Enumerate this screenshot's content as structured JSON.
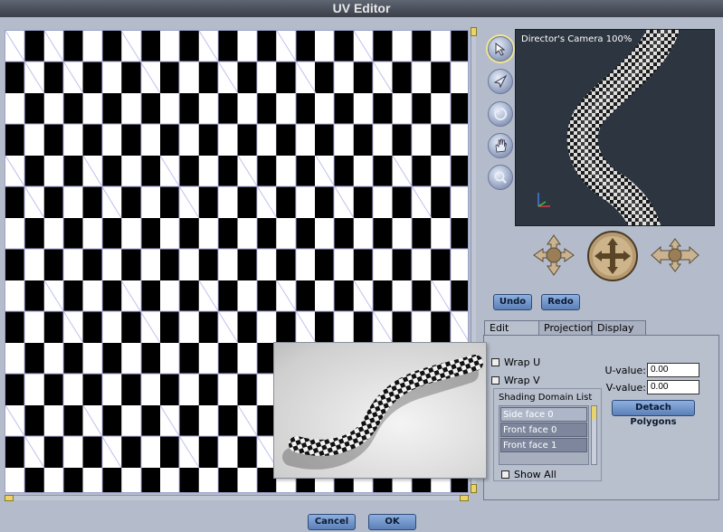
{
  "window": {
    "title": "UV Editor"
  },
  "camera": {
    "label": "Director's Camera 100%"
  },
  "tools": [
    "select-arrow-icon",
    "translate-icon",
    "rotate-icon",
    "hand-icon",
    "zoom-icon"
  ],
  "history": {
    "undo_label": "Undo",
    "redo_label": "Redo"
  },
  "tabs": [
    {
      "label": "Edit",
      "active": true
    },
    {
      "label": "Projection",
      "active": false
    },
    {
      "label": "Display",
      "active": false
    }
  ],
  "edit_panel": {
    "wrap_u_label": "Wrap U",
    "wrap_v_label": "Wrap V",
    "u_value_label": "U-value:",
    "u_value": "0.00",
    "v_value_label": "V-value:",
    "v_value": "0.00",
    "detach_label": "Detach Polygons",
    "domain_list_title": "Shading Domain List",
    "domain_items": [
      "Side face 0",
      "Front face 0",
      "Front face 1"
    ],
    "show_all_label": "Show All"
  },
  "footer": {
    "cancel_label": "Cancel",
    "ok_label": "OK"
  },
  "colors": {
    "accent": "#5b7fb8",
    "scroll_knob": "#e9d46a",
    "uv_grid": "#9aa2c8"
  }
}
